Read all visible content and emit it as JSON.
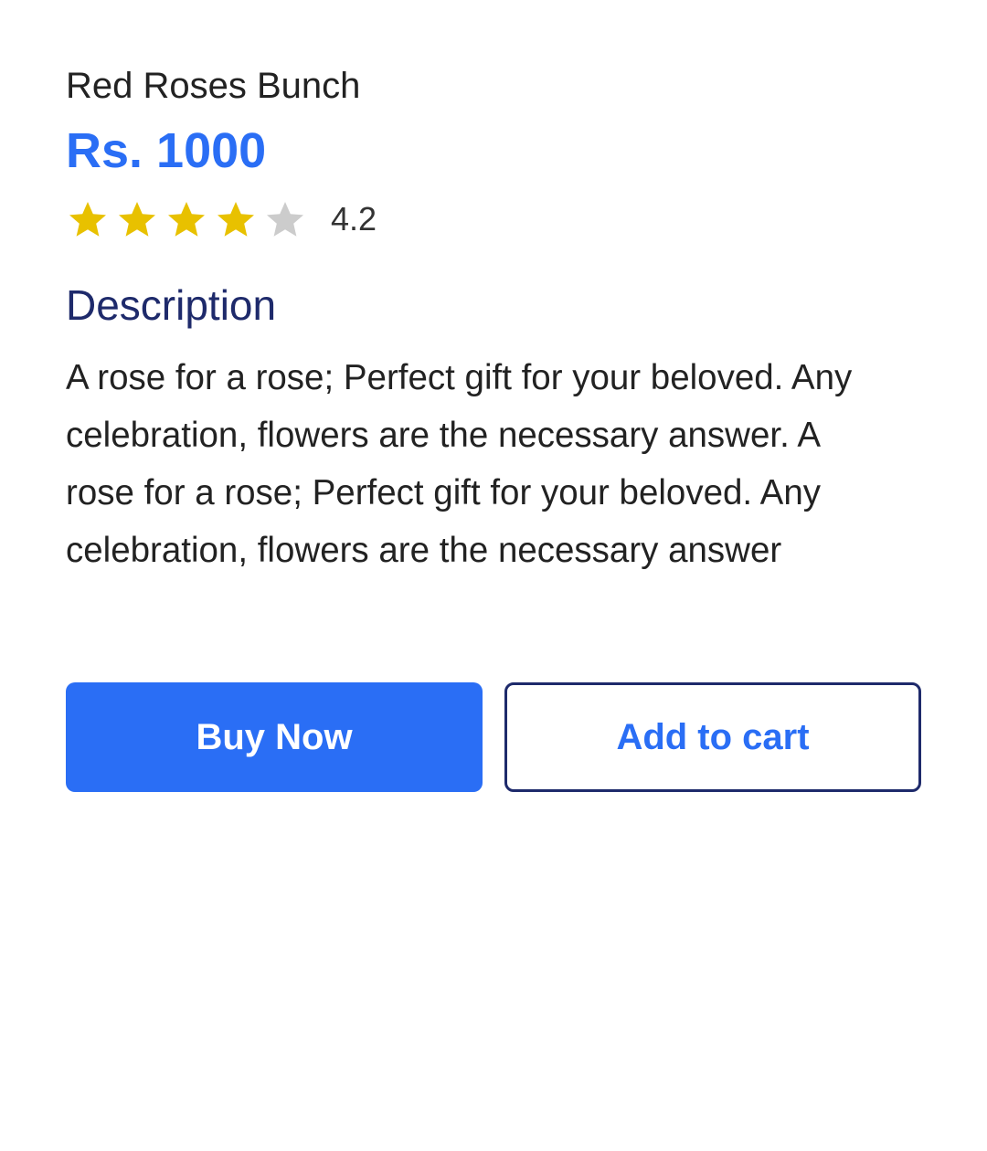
{
  "product": {
    "name": "Red Roses Bunch",
    "price": "Rs. 1000",
    "rating": {
      "value_label": "4.2",
      "filled_stars": 4,
      "total_stars": 5
    },
    "description_heading": "Description",
    "description": "A rose for a rose; Perfect gift for your beloved. Any celebration, flowers are the necessary answer. A rose for a rose; Perfect gift for your beloved. Any celebration, flowers are the necessary answer"
  },
  "actions": {
    "buy_label": "Buy Now",
    "cart_label": "Add to cart"
  },
  "colors": {
    "accent": "#2a6ef5",
    "heading": "#1e2a6b",
    "star_filled": "#e8c100",
    "star_empty": "#cccccc"
  },
  "icons": {
    "star": "star-icon"
  }
}
